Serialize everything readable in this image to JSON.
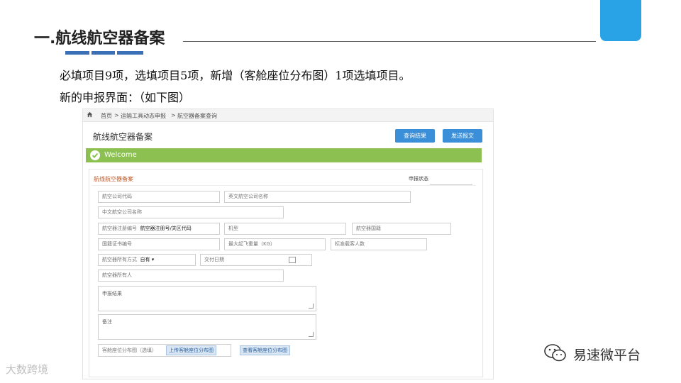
{
  "slide": {
    "title": "一.航线航空器备案",
    "line1": "必填项目9项，选填项目5项，新增（客舱座位分布图）1项选填项目。",
    "line2": "新的申报界面：（如下图）"
  },
  "screenshot": {
    "breadcrumb": [
      "首页",
      ">",
      "运输工具动态申报",
      ">",
      "航空器备案查询"
    ],
    "page_title": "航线航空器备案",
    "buttons": {
      "query_result": "查询结果",
      "send_message": "发送报文"
    },
    "welcome": "Welcome",
    "section_title": "航线航空器备案",
    "status_label": "申报状态",
    "fields": {
      "airline_code": "航空公司代码",
      "airline_name_en": "英文航空公司名称",
      "airline_name_cn": "中文航空公司名称",
      "reg_label": "航空器注册编号",
      "reg_value": "航空器注册号/关区代码",
      "model": "机型",
      "nationality": "航空器国籍",
      "cert_no": "国籍证书编号",
      "mtow": "最大起飞重量（KG）",
      "seats": "标准载客人数",
      "ownership_label": "航空器所有方式",
      "ownership_value": "自有",
      "delivery_date": "交付日期",
      "owner": "航空器所有人",
      "remarks": "申报结果",
      "notes": "备注",
      "seat_map_label": "客舱座位分布图（选填）",
      "upload_seat_map": "上传客舱座位分布图",
      "view_seat_map": "查看客舱座位分布图"
    }
  },
  "watermarks": {
    "left": "大数跨境",
    "right": "易速微平台"
  },
  "colors": {
    "accent_blue": "#3b6fb6",
    "corner_tab": "#29a3e6",
    "welcome_green": "#8cc152",
    "button_blue": "#3a8fd8"
  }
}
